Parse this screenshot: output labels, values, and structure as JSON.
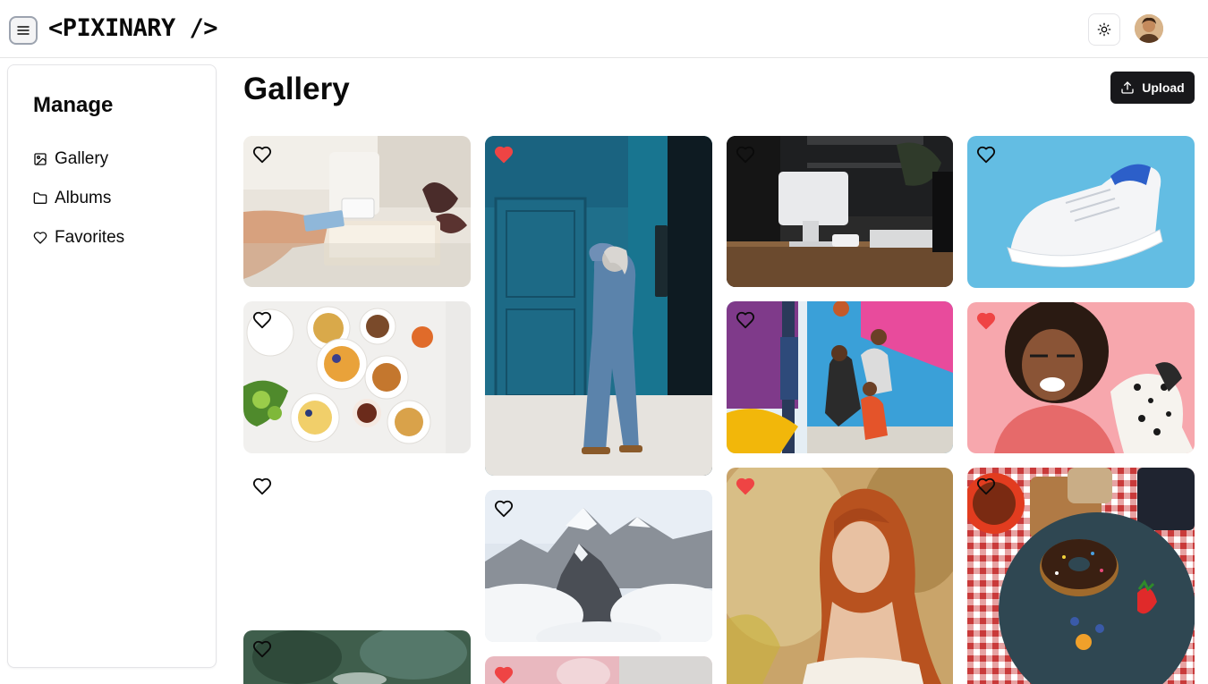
{
  "header": {
    "logo": "<PIXINARY />"
  },
  "sidebar": {
    "title": "Manage",
    "items": [
      {
        "label": "Gallery",
        "icon": "image-icon"
      },
      {
        "label": "Albums",
        "icon": "folder-icon"
      },
      {
        "label": "Favorites",
        "icon": "heart-icon"
      }
    ]
  },
  "main": {
    "title": "Gallery",
    "upload_label": "Upload"
  },
  "gallery": {
    "photos": [
      {
        "subject": "card payment terminal",
        "favorite": false
      },
      {
        "subject": "breakfast bowls on table",
        "favorite": false
      },
      {
        "subject": "blank image",
        "favorite": false
      },
      {
        "subject": "green plant close-up",
        "favorite": false
      },
      {
        "subject": "woman leaning by blue door",
        "favorite": true
      },
      {
        "subject": "snowy mountain peak",
        "favorite": false
      },
      {
        "subject": "pink wall",
        "favorite": true
      },
      {
        "subject": "point of sale counter",
        "favorite": false
      },
      {
        "subject": "basketball players",
        "favorite": false
      },
      {
        "subject": "red-haired woman portrait",
        "favorite": true
      },
      {
        "subject": "white sneaker",
        "favorite": false
      },
      {
        "subject": "laughing woman with dalmatian",
        "favorite": true
      },
      {
        "subject": "donut on plate",
        "favorite": false
      }
    ]
  },
  "colors": {
    "favorite_heart": "#ef4444",
    "upload_button": "#18181b"
  }
}
